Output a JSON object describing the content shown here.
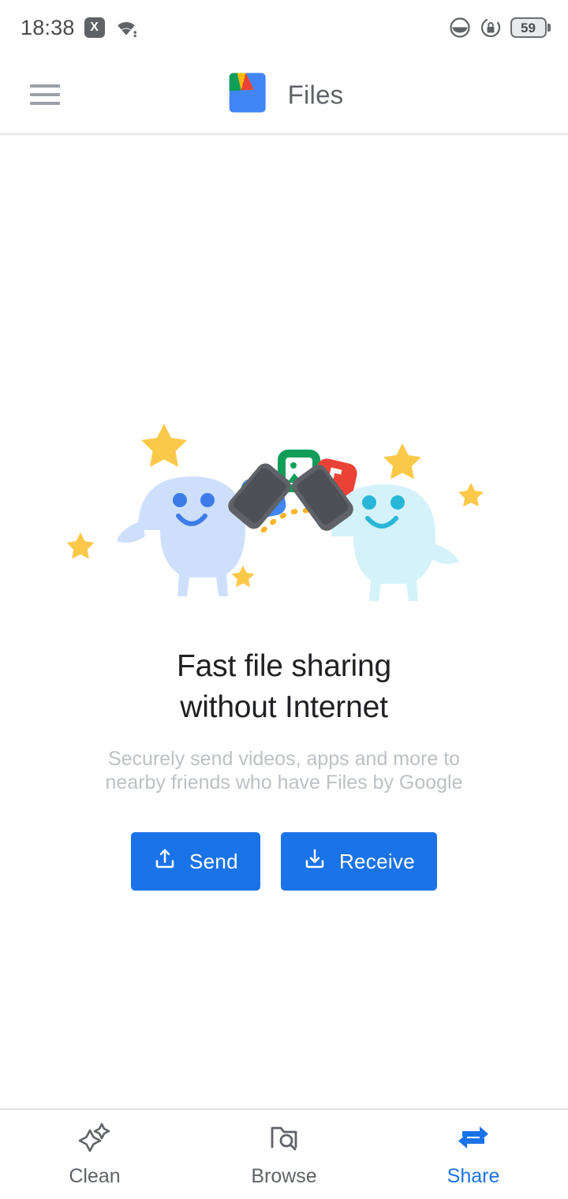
{
  "statusbar": {
    "time": "18:38",
    "x_badge_label": "X",
    "wifi_icon": "wifi-icon",
    "dnd_icon": "dark-theme-icon",
    "rotation_lock_icon": "rotation-lock-icon",
    "battery_level": "59"
  },
  "appbar": {
    "menu_icon": "hamburger-menu-icon",
    "logo_icon": "files-by-google-logo",
    "title": "Files"
  },
  "main": {
    "illustration_name": "two-blobs-sharing-files-illustration",
    "headline_line1": "Fast file sharing",
    "headline_line2": "without Internet",
    "subtitle_line1": "Securely send videos, apps and more to",
    "subtitle_line2": "nearby friends who have Files by Google",
    "buttons": [
      {
        "label": "Send",
        "icon": "upload-icon"
      },
      {
        "label": "Receive",
        "icon": "download-icon"
      }
    ]
  },
  "bottomnav": {
    "items": [
      {
        "label": "Clean",
        "icon": "sparkle-icon",
        "active": false
      },
      {
        "label": "Browse",
        "icon": "folder-search-icon",
        "active": false
      },
      {
        "label": "Share",
        "icon": "share-arrows-icon",
        "active": true
      }
    ]
  },
  "colors": {
    "accent": "#1a73e8",
    "text_primary": "#202124",
    "text_secondary": "#5f6368",
    "text_muted": "#bdc1c6",
    "background": "#ffffff",
    "blob_left": "#cddffb",
    "blob_right": "#d5f2fa",
    "star": "#fbc94a"
  }
}
